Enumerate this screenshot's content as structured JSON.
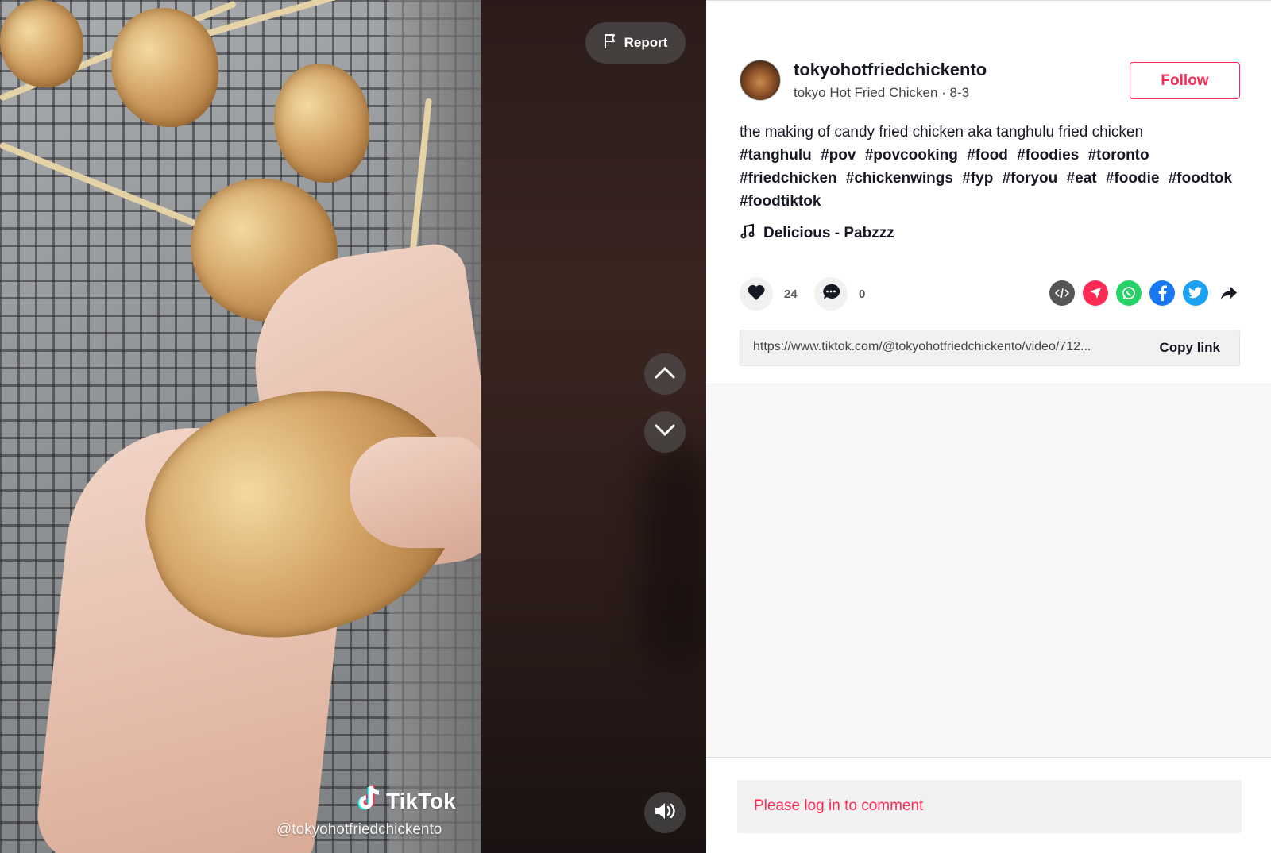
{
  "video": {
    "report_label": "Report",
    "watermark_brand": "TikTok",
    "watermark_user": "@tokyohotfriedchickento"
  },
  "post": {
    "username": "tokyohotfriedchickento",
    "display_name": "tokyo Hot Fried Chicken",
    "date": "8-3",
    "separator": " · ",
    "follow_label": "Follow",
    "description": "the making of candy fried chicken aka tanghulu fried chicken",
    "hashtags": [
      "#tanghulu",
      "#pov",
      "#povcooking",
      "#food",
      "#foodies",
      "#toronto",
      "#friedchicken",
      "#chickenwings",
      "#fyp",
      "#foryou",
      "#eat",
      "#foodie",
      "#foodtok",
      "#foodtiktok"
    ],
    "music": "Delicious - Pabzzz",
    "likes": "24",
    "comments": "0",
    "share_icons": [
      "embed-icon",
      "send-icon",
      "whatsapp-icon",
      "facebook-icon",
      "twitter-icon",
      "share-arrow-icon"
    ],
    "link": "https://www.tiktok.com/@tokyohotfriedchickento/video/712...",
    "copy_label": "Copy link",
    "login_prompt": "Please log in to comment"
  },
  "colors": {
    "accent": "#fe2c55",
    "embed": "#555555",
    "send": "#fe2c55",
    "whatsapp": "#25d366",
    "facebook": "#1877f2",
    "twitter": "#1da1f2"
  }
}
